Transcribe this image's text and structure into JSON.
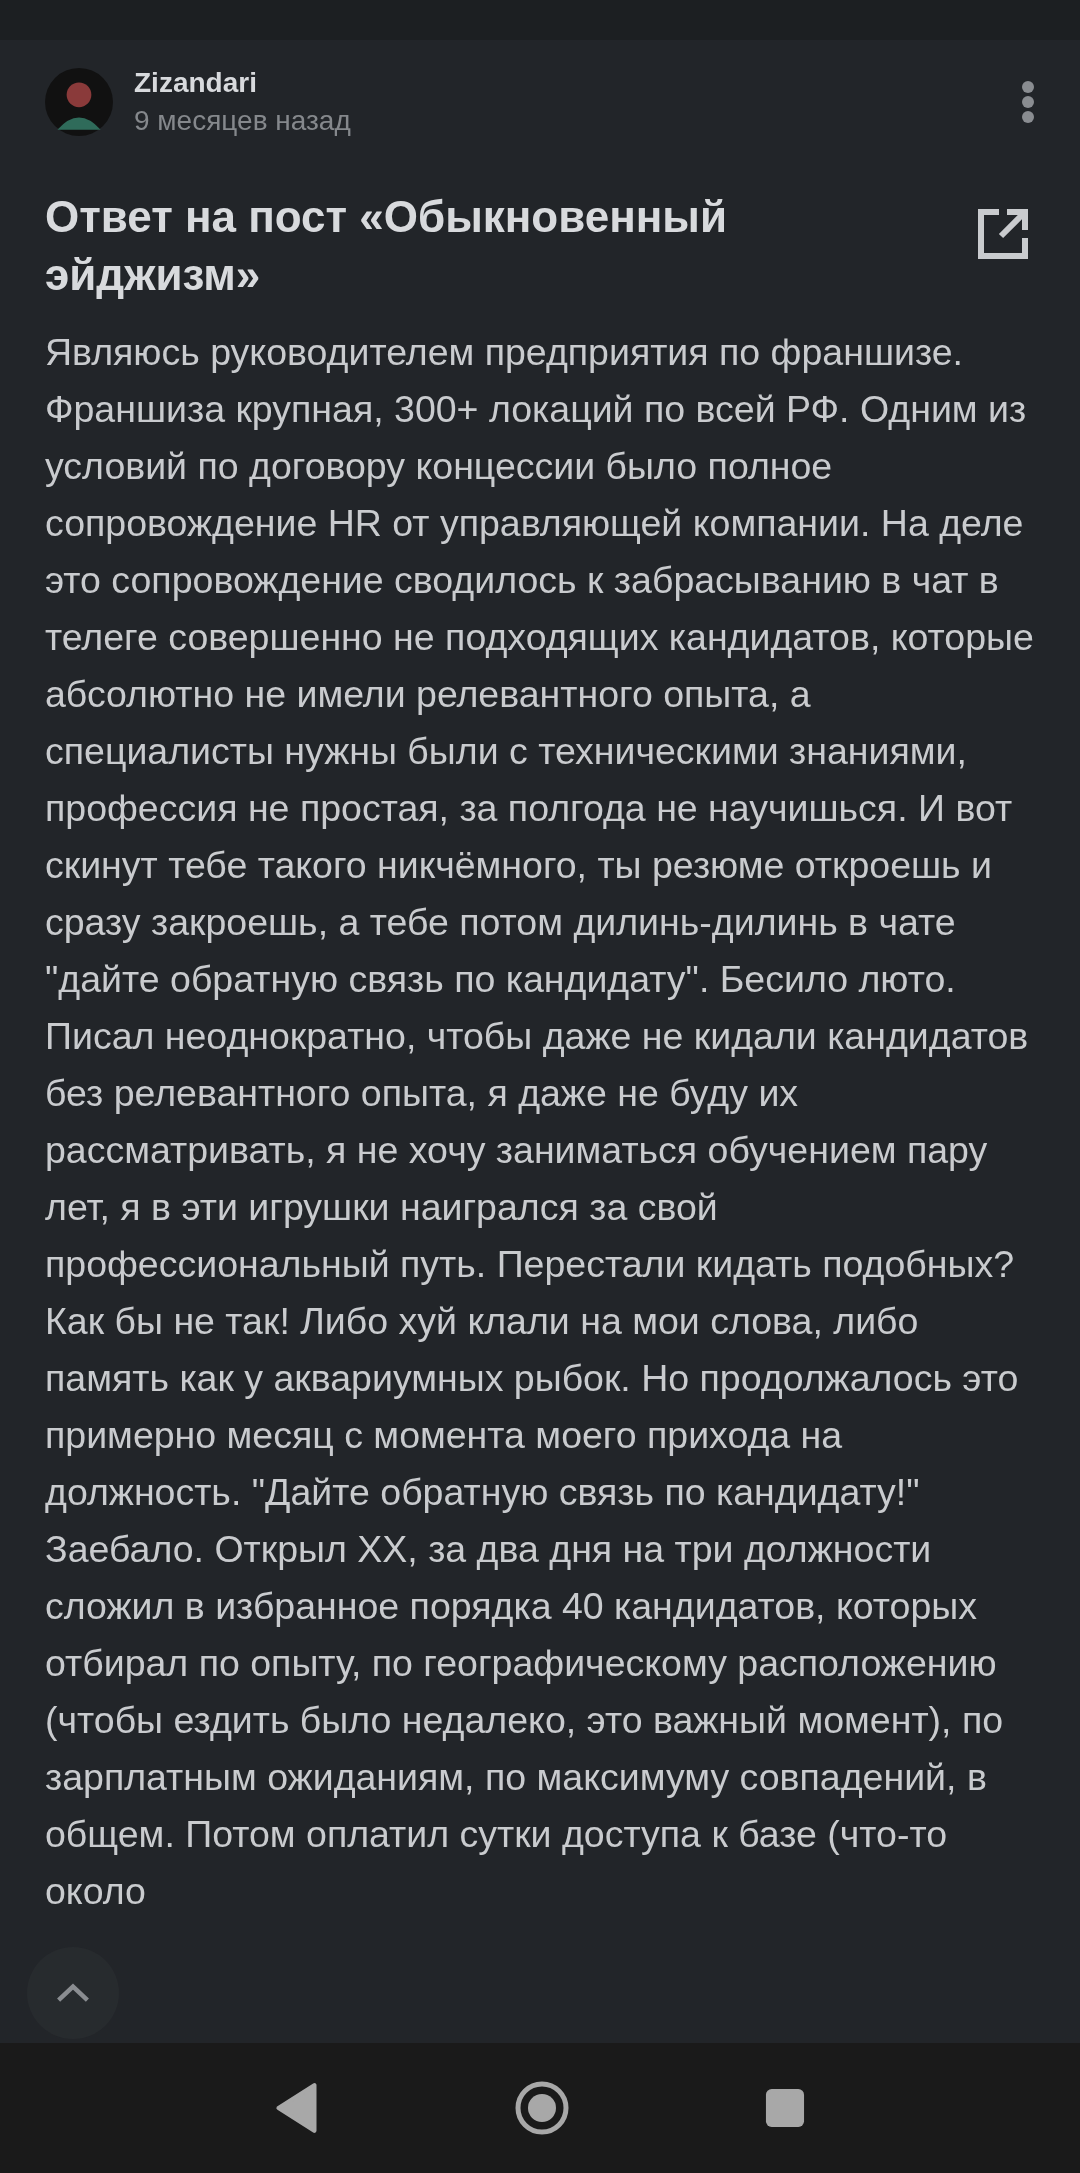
{
  "post": {
    "author": "Zizandari",
    "time": "9 месяцев назад",
    "title": "Ответ на пост «Обыкновенный эйджизм»",
    "body": "Являюсь руководителем предприятия по франшизе. Франшиза крупная, 300+ локаций по всей РФ. Одним из условий по договору концессии было полное сопровождение HR от управляющей компании. На деле это сопровождение сводилось к забрасыванию в чат в телеге совершенно не подходящих кандидатов, которые абсолютно не имели релевантного опыта, а специалисты нужны были с техническими знаниями, профессия не простая, за полгода не научишься. И вот скинут тебе такого никчёмного, ты резюме откроешь и сразу закроешь, а тебе потом дилинь-дилинь в чате \"дайте обратную связь по кандидату\". Бесило люто. Писал неоднократно, чтобы даже не кидали кандидатов без релевантного опыта, я даже не буду их рассматривать, я не хочу заниматься обучением пару лет, я в эти игрушки наигрался за свой профессиональный путь. Перестали кидать подобных? Как бы не так! Либо хуй клали на мои слова, либо память как у аквариумных рыбок. Но продолжалось это примерно месяц с момента моего прихода на должность. \"Дайте обратную связь по кандидату!\" Заебало. Открыл ХХ, за два дня на три должности сложил в избранное порядка 40 кандидатов, которых отбирал по опыту, по географическому расположению (чтобы ездить было недалеко, это важный момент), по зарплатным ожиданиям, по максимуму совпадений, в общем. Потом оплатил сутки доступа к базе (что-то около"
  }
}
